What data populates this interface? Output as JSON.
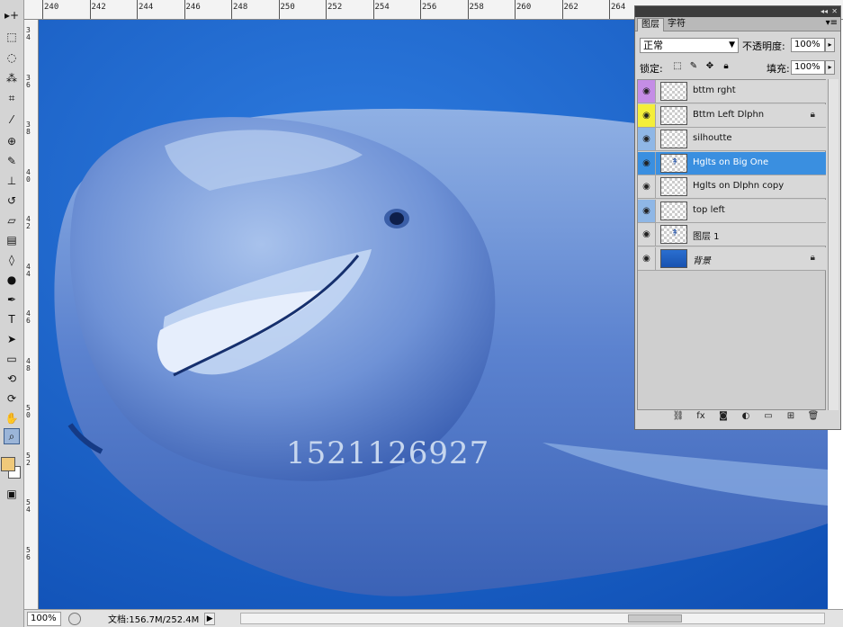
{
  "ruler": {
    "top_labels": [
      "240",
      "242",
      "244",
      "246",
      "248",
      "250",
      "252",
      "254",
      "256",
      "258",
      "260",
      "262",
      "264"
    ],
    "left_labels": [
      "34",
      "36",
      "38",
      "40",
      "42",
      "44",
      "46",
      "48",
      "50",
      "52",
      "54",
      "56"
    ]
  },
  "toolbox": {
    "tools": [
      {
        "name": "move-tool",
        "glyph": "▸+"
      },
      {
        "name": "marquee-tool",
        "glyph": "⬚"
      },
      {
        "name": "lasso-tool",
        "glyph": "◌"
      },
      {
        "name": "quick-select-tool",
        "glyph": "⁂"
      },
      {
        "name": "crop-tool",
        "glyph": "⌗"
      },
      {
        "name": "eyedropper-tool",
        "glyph": "⁄"
      },
      {
        "name": "healing-brush-tool",
        "glyph": "⊕"
      },
      {
        "name": "brush-tool",
        "glyph": "✎"
      },
      {
        "name": "clone-stamp-tool",
        "glyph": "⊥"
      },
      {
        "name": "history-brush-tool",
        "glyph": "↺"
      },
      {
        "name": "eraser-tool",
        "glyph": "▱"
      },
      {
        "name": "gradient-tool",
        "glyph": "▤"
      },
      {
        "name": "blur-tool",
        "glyph": "◊"
      },
      {
        "name": "dodge-tool",
        "glyph": "●"
      },
      {
        "name": "pen-tool",
        "glyph": "✒"
      },
      {
        "name": "type-tool",
        "glyph": "T"
      },
      {
        "name": "path-select-tool",
        "glyph": "➤"
      },
      {
        "name": "shape-tool",
        "glyph": "▭"
      },
      {
        "name": "3d-rotate-tool",
        "glyph": "⟲"
      },
      {
        "name": "3d-orbit-tool",
        "glyph": "⟳"
      },
      {
        "name": "hand-tool",
        "glyph": "✋"
      },
      {
        "name": "zoom-tool",
        "glyph": "⌕"
      }
    ],
    "foreground_color": "#f0c97a",
    "background_color": "#ffffff"
  },
  "canvas": {
    "watermark": "1521126927"
  },
  "status": {
    "zoom": "100%",
    "doc_info": "文档:156.7M/252.4M",
    "arrow": "▶"
  },
  "layers_panel": {
    "tabs": [
      "图层",
      "字符"
    ],
    "blend_mode": "正常",
    "opacity_label": "不透明度:",
    "opacity_value": "100%",
    "lock_label": "锁定:",
    "fill_label": "填充:",
    "fill_value": "100%",
    "selected_layer": "Hglts on Big One",
    "layers": [
      {
        "name": "bttm rght",
        "eye_color": "#c48de6",
        "locked": false,
        "thumb": "transparent"
      },
      {
        "name": "Bttm Left Dlphn",
        "eye_color": "#f4ee3a",
        "locked": true,
        "thumb": "transparent"
      },
      {
        "name": "silhoutte",
        "eye_color": "#8fb7e6",
        "locked": false,
        "thumb": "transparent"
      },
      {
        "name": "Hglts on Big One",
        "eye_color": "",
        "locked": false,
        "thumb": "mark"
      },
      {
        "name": "Hglts on Dlphn copy",
        "eye_color": "",
        "locked": false,
        "thumb": "transparent"
      },
      {
        "name": "top left",
        "eye_color": "#8fb7e6",
        "locked": false,
        "thumb": "transparent"
      },
      {
        "name": "图层 1",
        "eye_color": "",
        "locked": false,
        "thumb": "mark"
      },
      {
        "name": "背景",
        "eye_color": "",
        "locked": true,
        "thumb": "bg"
      }
    ],
    "bottom_icons": [
      "link-icon",
      "fx-icon",
      "mask-icon",
      "adjustment-icon",
      "group-icon",
      "new-layer-icon",
      "trash-icon"
    ]
  }
}
